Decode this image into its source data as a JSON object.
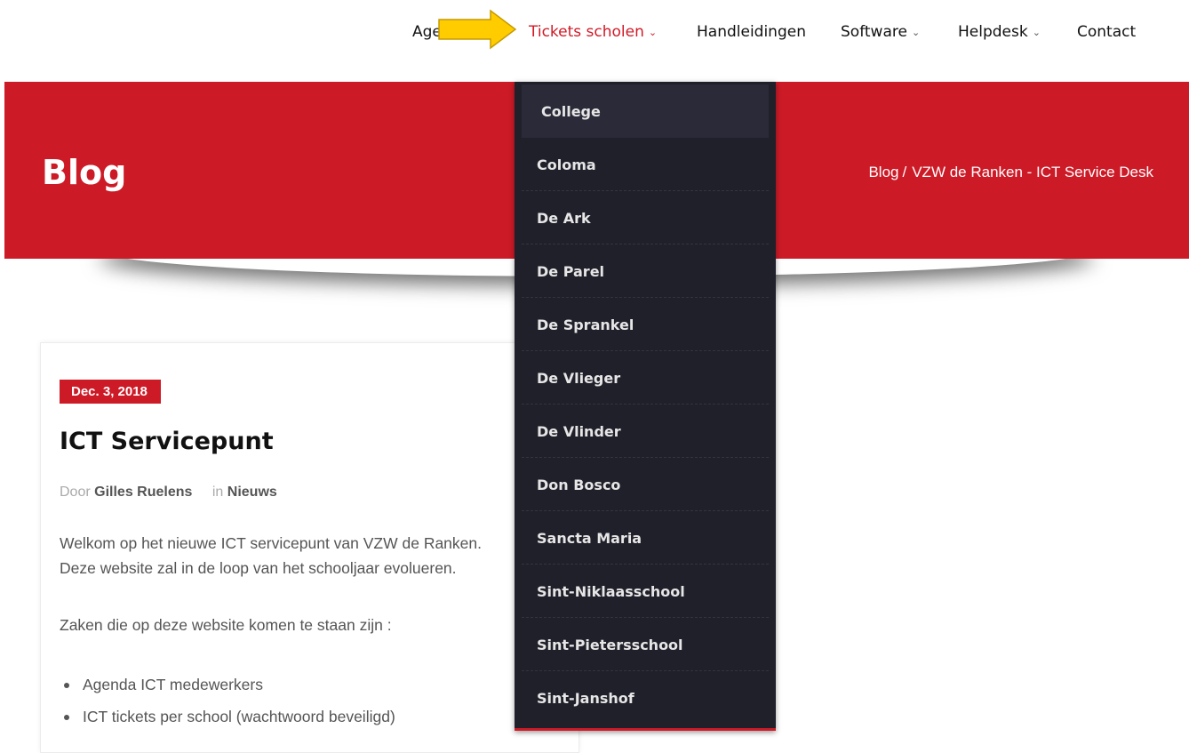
{
  "nav": {
    "items": [
      {
        "label": "Agenda",
        "dropdown": false
      },
      {
        "label": "Tickets scholen",
        "dropdown": true,
        "active": true
      },
      {
        "label": "Handleidingen",
        "dropdown": false
      },
      {
        "label": "Software",
        "dropdown": true
      },
      {
        "label": "Helpdesk",
        "dropdown": true
      },
      {
        "label": "Contact",
        "dropdown": false
      }
    ],
    "chevron": "⌄"
  },
  "annotation": {
    "icon": "yellow-arrow-icon",
    "color": "#ffcc00"
  },
  "hero": {
    "title": "Blog",
    "breadcrumb": [
      "Blog",
      "VZW de Ranken - ICT Service Desk"
    ],
    "separator": "/",
    "color": "#cd1a27"
  },
  "dropdown": {
    "items": [
      "College",
      "Coloma",
      "De Ark",
      "De Parel",
      "De Sprankel",
      "De Vlieger",
      "De Vlinder",
      "Don Bosco",
      "Sancta Maria",
      "Sint-Niklaasschool",
      "Sint-Pietersschool",
      "Sint-Janshof"
    ]
  },
  "post": {
    "date": "Dec. 3, 2018",
    "title": "ICT Servicepunt",
    "meta": {
      "by_label": "Door",
      "author": "Gilles Ruelens",
      "in_label": "in",
      "category": "Nieuws"
    },
    "paragraphs": [
      "Welkom op het nieuwe ICT servicepunt van VZW de Ranken.",
      "Deze website zal in de loop van het schooljaar evolueren.",
      "Zaken die op deze website komen te staan zijn :"
    ],
    "bullets": [
      "Agenda ICT medewerkers",
      "ICT tickets per school (wachtwoord beveiligd)"
    ]
  }
}
